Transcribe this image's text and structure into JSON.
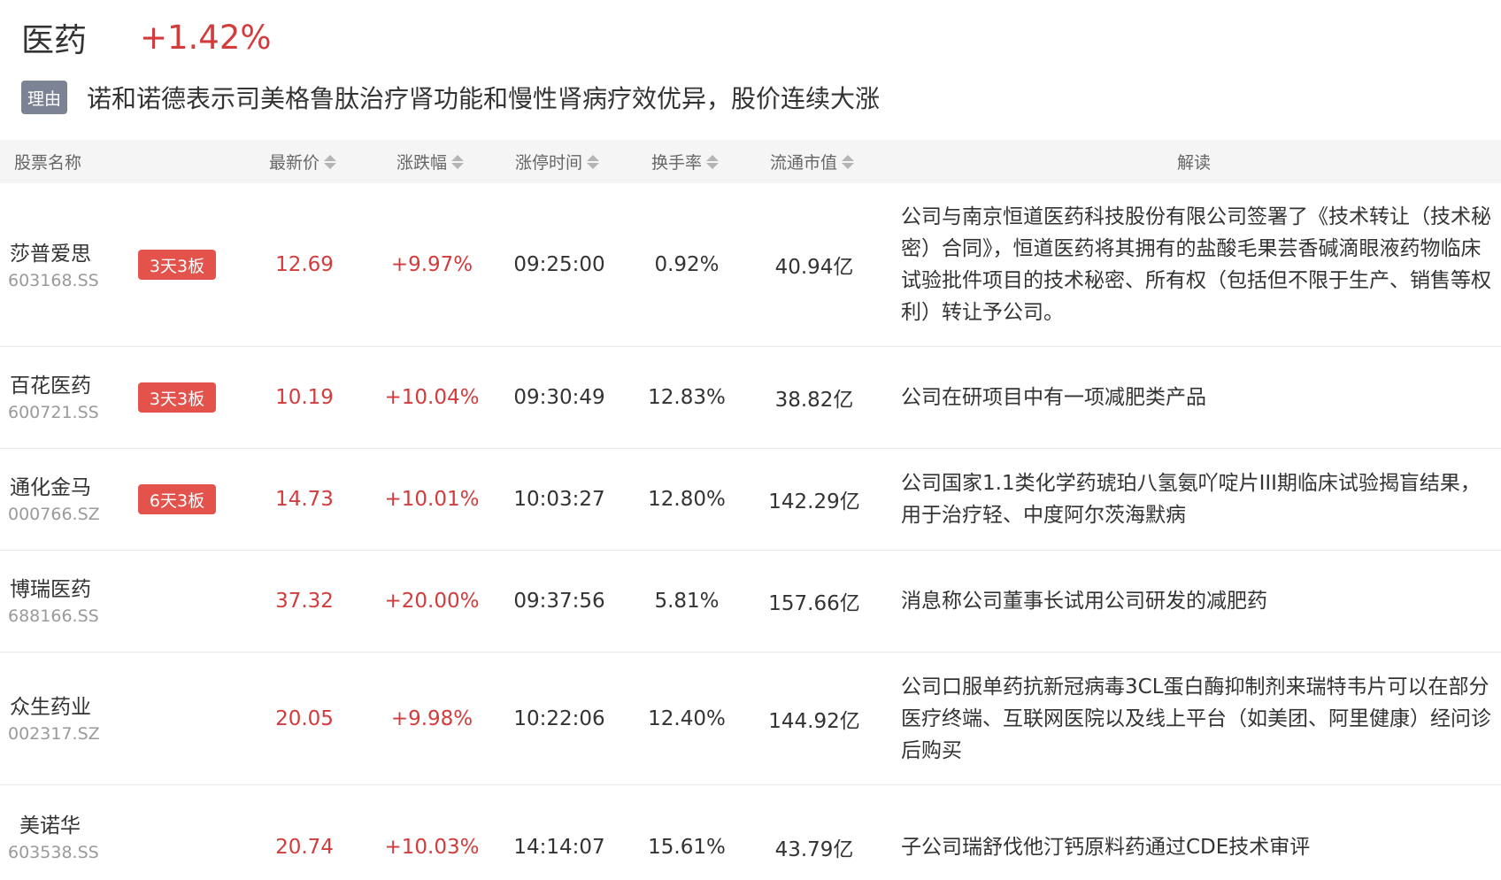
{
  "sector": {
    "name": "医药",
    "change": "+1.42%",
    "change_color": "#d23c3c"
  },
  "reason": {
    "tag": "理由",
    "text": "诺和诺德表示司美格鲁肽治疗肾功能和慢性肾病疗效优异，股价连续大涨"
  },
  "columns": {
    "name": "股票名称",
    "price": "最新价",
    "change": "涨跌幅",
    "limit_time": "涨停时间",
    "turnover": "换手率",
    "float_cap": "流通市值",
    "analysis": "解读"
  },
  "rows": [
    {
      "name": "莎普爱思",
      "code": "603168.SS",
      "badge": "3天3板",
      "price": "12.69",
      "change": "+9.97%",
      "time": "09:25:00",
      "turnover": "0.92%",
      "cap": "40.94亿",
      "desc": "公司与南京恒道医药科技股份有限公司签署了《技术转让（技术秘密）合同》，恒道医药将其拥有的盐酸毛果芸香碱滴眼液药物临床试验批件项目的技术秘密、所有权（包括但不限于生产、销售等权利）转让予公司。"
    },
    {
      "name": "百花医药",
      "code": "600721.SS",
      "badge": "3天3板",
      "price": "10.19",
      "change": "+10.04%",
      "time": "09:30:49",
      "turnover": "12.83%",
      "cap": "38.82亿",
      "desc": "公司在研项目中有一项减肥类产品"
    },
    {
      "name": "通化金马",
      "code": "000766.SZ",
      "badge": "6天3板",
      "price": "14.73",
      "change": "+10.01%",
      "time": "10:03:27",
      "turnover": "12.80%",
      "cap": "142.29亿",
      "desc": "公司国家1.1类化学药琥珀八氢氨吖啶片III期临床试验揭盲结果，用于治疗轻、中度阿尔茨海默病"
    },
    {
      "name": "博瑞医药",
      "code": "688166.SS",
      "badge": "",
      "price": "37.32",
      "change": "+20.00%",
      "time": "09:37:56",
      "turnover": "5.81%",
      "cap": "157.66亿",
      "desc": "消息称公司董事长试用公司研发的减肥药"
    },
    {
      "name": "众生药业",
      "code": "002317.SZ",
      "badge": "",
      "price": "20.05",
      "change": "+9.98%",
      "time": "10:22:06",
      "turnover": "12.40%",
      "cap": "144.92亿",
      "desc": "公司口服单药抗新冠病毒3CL蛋白酶抑制剂来瑞特韦片可以在部分医疗终端、互联网医院以及线上平台（如美团、阿里健康）经问诊后购买"
    },
    {
      "name": "美诺华",
      "code": "603538.SS",
      "badge": "",
      "price": "20.74",
      "change": "+10.03%",
      "time": "14:14:07",
      "turnover": "15.61%",
      "cap": "43.79亿",
      "desc": "子公司瑞舒伐他汀钙原料药通过CDE技术审评"
    }
  ]
}
